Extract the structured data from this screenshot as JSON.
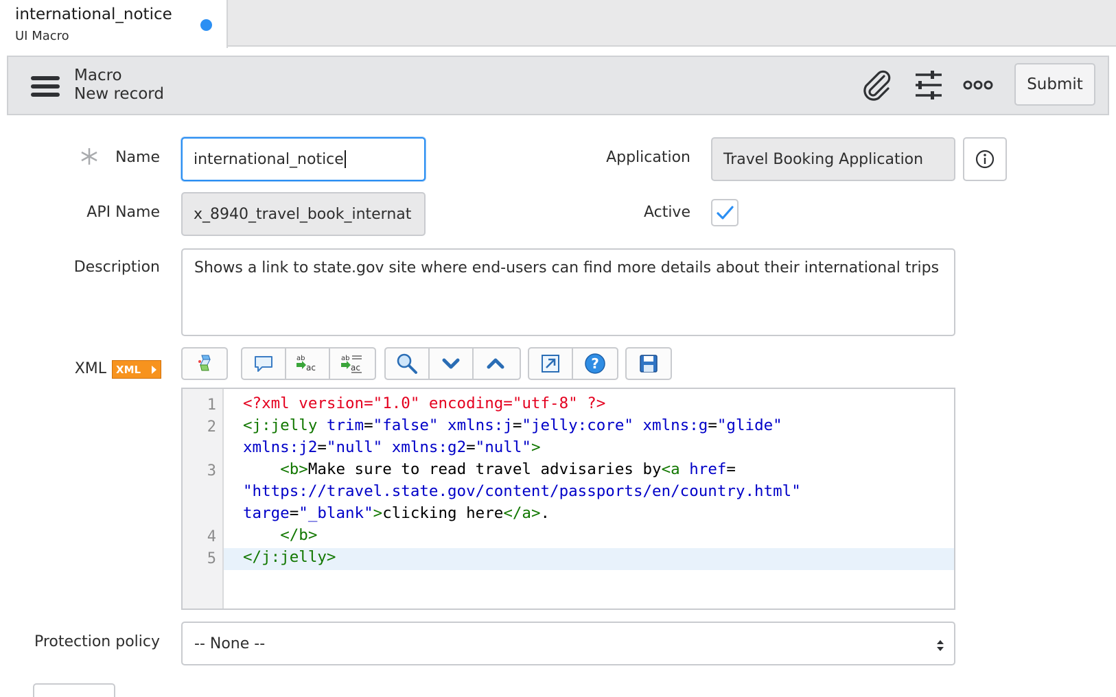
{
  "tab": {
    "title": "international_notice",
    "subtitle": "UI Macro"
  },
  "header": {
    "title": "Macro",
    "subtitle": "New record",
    "submit_label": "Submit",
    "icons": [
      "paperclip-icon",
      "sliders-icon",
      "more-icon"
    ]
  },
  "form": {
    "name_label": "Name",
    "name_value": "international_notice",
    "application_label": "Application",
    "application_value": "Travel Booking Application",
    "api_name_label": "API Name",
    "api_name_value": "x_8940_travel_book_internat",
    "active_label": "Active",
    "active_checked": true,
    "description_label": "Description",
    "description_value": "Shows a link to state.gov site where end-users can find more details about their international trips",
    "xml_label": "XML",
    "xml_badge": "XML",
    "protection_label": "Protection policy",
    "protection_value": "-- None --"
  },
  "toolbar": {
    "groups": [
      [
        "format-code-icon"
      ],
      [
        "comment-icon",
        "replace-icon",
        "replace-all-icon"
      ],
      [
        "search-icon",
        "find-next-icon",
        "find-previous-icon"
      ],
      [
        "fullscreen-icon",
        "help-icon"
      ],
      [
        "save-icon"
      ]
    ]
  },
  "code": {
    "line_numbers": [
      "1",
      "2",
      "3",
      "4",
      "5"
    ],
    "active_line": 5,
    "lines": [
      [
        [
          "red",
          "<?xml version=\"1.0\" encoding=\"utf-8\" ?>"
        ]
      ],
      [
        [
          "grn",
          "<j:jelly "
        ],
        [
          "blu",
          "trim"
        ],
        [
          "blk",
          "="
        ],
        [
          "blu",
          "\"false\" xmlns:j"
        ],
        [
          "blk",
          "="
        ],
        [
          "blu",
          "\"jelly:core\" xmlns:g"
        ],
        [
          "blk",
          "="
        ],
        [
          "blu",
          "\"glide\""
        ]
      ],
      [
        [
          "blu",
          "xmlns:j2"
        ],
        [
          "blk",
          "="
        ],
        [
          "blu",
          "\"null\" xmlns:g2"
        ],
        [
          "blk",
          "="
        ],
        [
          "blu",
          "\"null\""
        ],
        [
          "grn",
          ">"
        ]
      ],
      [
        [
          "blk",
          "    "
        ],
        [
          "grn",
          "<b>"
        ],
        [
          "blk",
          "Make sure to read travel advisaries by"
        ],
        [
          "grn",
          "<a "
        ],
        [
          "blu",
          "href"
        ],
        [
          "blk",
          "="
        ]
      ],
      [
        [
          "blu",
          "\"https://travel.state.gov/content/passports/en/country.html\""
        ]
      ],
      [
        [
          "blu",
          "targe"
        ],
        [
          "blk",
          "="
        ],
        [
          "blu",
          "\"_blank\""
        ],
        [
          "grn",
          ">"
        ],
        [
          "blk",
          "clicking here"
        ],
        [
          "grn",
          "</a>"
        ],
        [
          "blk",
          "."
        ]
      ],
      [
        [
          "blk",
          "    "
        ],
        [
          "grn",
          "</b>"
        ]
      ],
      [
        [
          "grn",
          "</j:jelly>"
        ]
      ]
    ]
  },
  "colors": {
    "accent": "#2b8ff3",
    "code_red": "#e4001f",
    "code_green": "#117700",
    "code_blue": "#0000c8",
    "xml_badge": "#f7931e"
  }
}
